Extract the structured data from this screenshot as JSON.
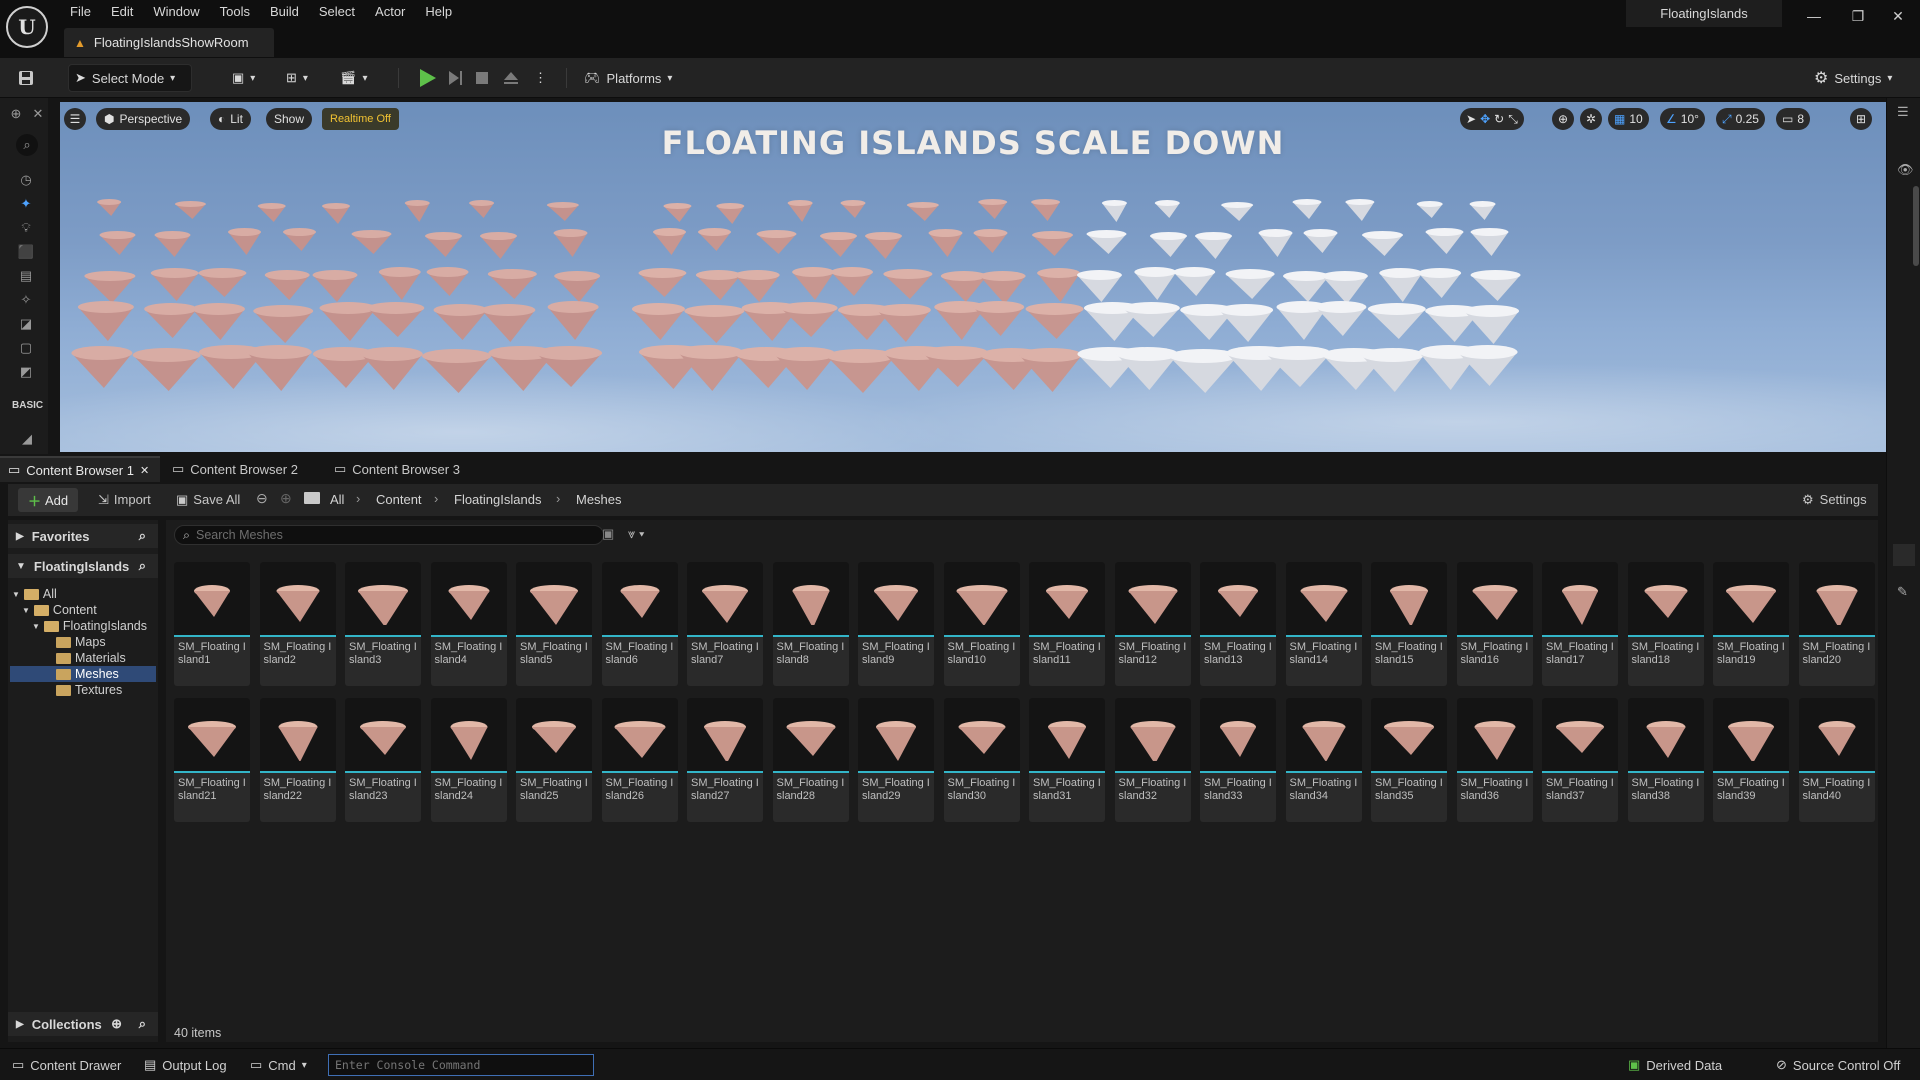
{
  "window": {
    "project_name": "FloatingIslands",
    "document_tab": "FloatingIslandsShowRoom"
  },
  "menu": [
    "File",
    "Edit",
    "Window",
    "Tools",
    "Build",
    "Select",
    "Actor",
    "Help"
  ],
  "toolbar": {
    "select_mode": "Select Mode",
    "platforms": "Platforms",
    "settings": "Settings"
  },
  "mode_panel": {
    "basic_label": "BASIC"
  },
  "viewport": {
    "perspective": "Perspective",
    "lit": "Lit",
    "show": "Show",
    "realtime": "Realtime Off",
    "title": "FLOATING ISLANDS SCALE DOWN",
    "grid_snap": "10",
    "angle_snap": "10°",
    "scale_snap": "0.25",
    "camera_speed": "8"
  },
  "content_tabs": [
    "Content Browser 1",
    "Content Browser 2",
    "Content Browser 3"
  ],
  "cb_toolbar": {
    "add": "Add",
    "import": "Import",
    "save_all": "Save All",
    "path": [
      "All",
      "Content",
      "FloatingIslands",
      "Meshes"
    ],
    "settings": "Settings"
  },
  "sources": {
    "favorites": "Favorites",
    "root": "FloatingIslands",
    "tree": [
      "All",
      "Content",
      "FloatingIslands",
      "Maps",
      "Materials",
      "Meshes",
      "Textures"
    ],
    "collections": "Collections"
  },
  "search": {
    "placeholder": "Search Meshes"
  },
  "assets": [
    "SM_Floating Island1",
    "SM_Floating Island2",
    "SM_Floating Island3",
    "SM_Floating Island4",
    "SM_Floating Island5",
    "SM_Floating Island6",
    "SM_Floating Island7",
    "SM_Floating Island8",
    "SM_Floating Island9",
    "SM_Floating Island10",
    "SM_Floating Island11",
    "SM_Floating Island12",
    "SM_Floating Island13",
    "SM_Floating Island14",
    "SM_Floating Island15",
    "SM_Floating Island16",
    "SM_Floating Island17",
    "SM_Floating Island18",
    "SM_Floating Island19",
    "SM_Floating Island20",
    "SM_Floating Island21",
    "SM_Floating Island22",
    "SM_Floating Island23",
    "SM_Floating Island24",
    "SM_Floating Island25",
    "SM_Floating Island26",
    "SM_Floating Island27",
    "SM_Floating Island28",
    "SM_Floating Island29",
    "SM_Floating Island30",
    "SM_Floating Island31",
    "SM_Floating Island32",
    "SM_Floating Island33",
    "SM_Floating Island34",
    "SM_Floating Island35",
    "SM_Floating Island36",
    "SM_Floating Island37",
    "SM_Floating Island38",
    "SM_Floating Island39",
    "SM_Floating Island40"
  ],
  "item_count": "40 items",
  "statusbar": {
    "content_drawer": "Content Drawer",
    "output_log": "Output Log",
    "cmd": "Cmd",
    "console_placeholder": "Enter Console Command",
    "derived_data": "Derived Data",
    "source_control": "Source Control Off"
  },
  "colors": {
    "accent_blue": "#2f4a77",
    "asset_bar": "#33b5c8",
    "play_green": "#5ec04a",
    "island_rock": "#c8968a"
  }
}
